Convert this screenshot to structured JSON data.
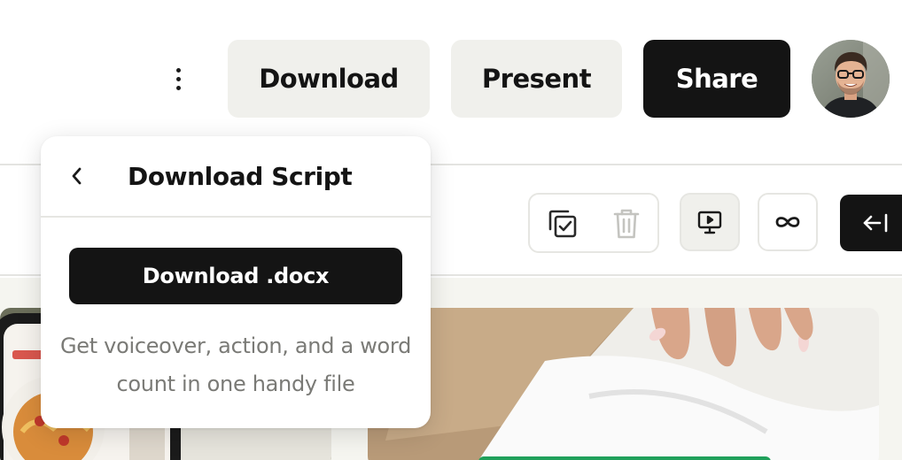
{
  "header": {
    "more_icon": "more-vertical-icon",
    "download_label": "Download",
    "present_label": "Present",
    "share_label": "Share"
  },
  "toolbar": {
    "icons": [
      "copy-check-icon",
      "trash-icon",
      "presentation-play-icon",
      "infinity-loop-icon",
      "collapse-left-icon"
    ]
  },
  "popover": {
    "back_icon": "chevron-left-icon",
    "title": "Download Script",
    "action_label": "Download .docx",
    "description": "Get voiceover, action, and a word count in one handy file"
  },
  "colors": {
    "primary_dark": "#141414",
    "button_light": "#f0f0ec",
    "canvas_bg": "#f5f5f0",
    "muted_text": "#7a7a76",
    "divider": "#e4e4e1"
  }
}
